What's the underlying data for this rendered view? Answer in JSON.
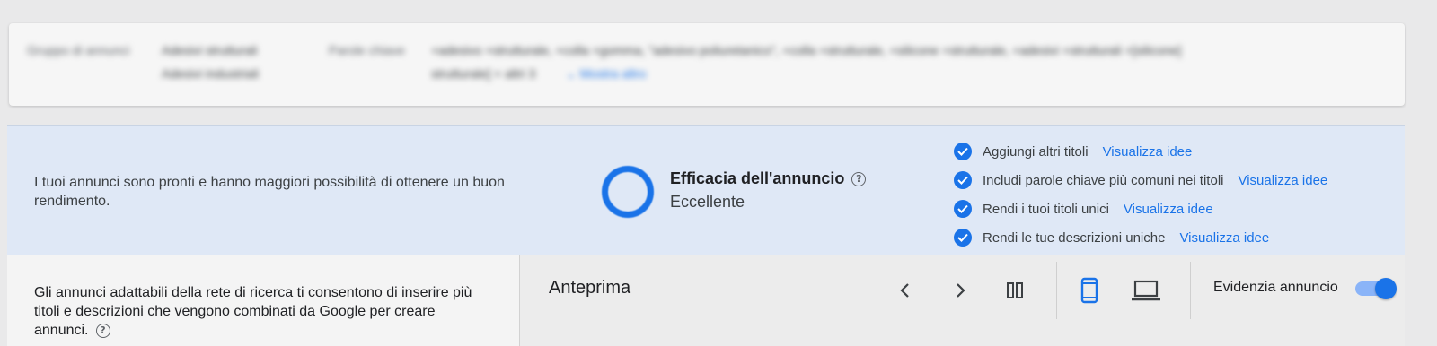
{
  "top_card": {
    "group_label": "Gruppo di annunci",
    "group_value_1": "Adesivi strutturali",
    "group_value_2": "Adesivi industriali",
    "keywords_label": "Parole chiave",
    "keywords_line_1": "+adesivo +strutturale, +colla +gomma, \"adesivo poliuretanico\", +colla +strutturale, +silicone +strutturale, +adesivi +strutturali +[silicone]",
    "keywords_line_2": "strutturale] + altri 3",
    "show_more": "Mostra altro"
  },
  "strength": {
    "message": "I tuoi annunci sono pronti e hanno maggiori possibilità di ottenere un buon rendimento.",
    "title": "Efficacia dell'annuncio",
    "help": "?",
    "value": "Eccellente",
    "level": 1.0,
    "checks": [
      {
        "text": "Aggiungi altri titoli",
        "link": "Visualizza idee"
      },
      {
        "text": "Includi parole chiave più comuni nei titoli",
        "link": "Visualizza idee"
      },
      {
        "text": "Rendi i tuoi titoli unici",
        "link": "Visualizza idee"
      },
      {
        "text": "Rendi le tue descrizioni uniche",
        "link": "Visualizza idee"
      }
    ]
  },
  "info": {
    "text": "Gli annunci adattabili della rete di ricerca ti consentono di inserire più titoli e descrizioni che vengono combinati da Google per creare annunci.",
    "help": "?"
  },
  "preview": {
    "title": "Anteprima",
    "highlight_label": "Evidenzia annuncio",
    "highlight_on": true,
    "accent": "#1a73e8"
  }
}
